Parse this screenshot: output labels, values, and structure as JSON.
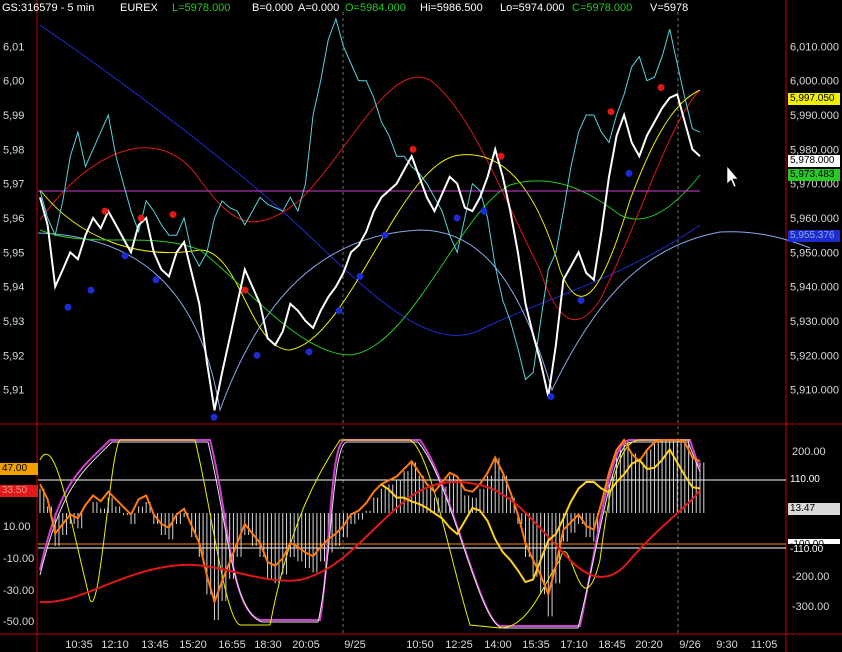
{
  "header": {
    "symbol": "GS:316579 - 5 min",
    "exchange": "EUREX",
    "last": "L=5978.000",
    "bid": "B=0.000",
    "ask": "A=0.000",
    "open": "O=5984.000",
    "high": "Hi=5986.500",
    "low": "Lo=5974.000",
    "close": "C=5978.000",
    "volume": "V=5978"
  },
  "colors": {
    "background": "#000000",
    "price": "#ffffff",
    "cyan": "#5ad2dc",
    "red": "#e01818",
    "yellow": "#f0f000",
    "green": "#28c828",
    "blue": "#1c2cd0",
    "lightblue": "#8aa8e8",
    "magenta": "#d040d0",
    "orange": "#ff7a10",
    "axis_red": "#c00000"
  },
  "price_axis": {
    "left_labels": [
      "6,01",
      "6,00",
      "5,99",
      "5,98",
      "5,97",
      "5,96",
      "5,95",
      "5,94",
      "5,93",
      "5,92",
      "5,91"
    ],
    "right_labels": [
      "6,010.000",
      "6,000.000",
      "5,990.000",
      "5,980.000",
      "5,970.000",
      "5,960.000",
      "5,950.000",
      "5,940.000",
      "5,930.000",
      "5,920.000",
      "5,910.000"
    ],
    "tags": [
      {
        "text": "5,997.050",
        "bg": "#f0f000"
      },
      {
        "text": "5,978.000",
        "bg": "#ffffff"
      },
      {
        "text": "5,973.483",
        "bg": "#28c828"
      },
      {
        "text": "5,955.376",
        "bg": "#1c2cd0"
      }
    ]
  },
  "osc_axis": {
    "left_labels": [
      "10.00",
      "-10.00",
      "-30.00",
      "-50.00"
    ],
    "right_labels": [
      "200.00",
      "-200.00",
      "-300.00"
    ],
    "left_tags": [
      {
        "text": "47.00",
        "bg": "#f0a000",
        "fg": "#000000"
      },
      {
        "text": "33.50",
        "bg": "#e01818",
        "fg": "#ff9090"
      }
    ],
    "right_tags": [
      {
        "text": "110.00",
        "bg": "#000000",
        "fg": "#ffffff"
      },
      {
        "text": "13.47",
        "bg": "#d8d8d8",
        "fg": "#000000"
      },
      {
        "text": "-100.00",
        "bg": "#ffffff",
        "fg": "#000000"
      },
      {
        "text": "-110.00",
        "bg": "#000000",
        "fg": "#ffffff"
      }
    ]
  },
  "time_axis": {
    "labels": [
      "10:35",
      "12:10",
      "13:45",
      "15:20",
      "16:55",
      "18:30",
      "20:05",
      "9/25",
      "10:50",
      "12:25",
      "14:00",
      "15:35",
      "17:10",
      "18:45",
      "20:20",
      "9/26",
      "9:30",
      "11:05"
    ]
  },
  "chart_data": {
    "type": "line",
    "title": "GS:316579 - 5 min",
    "x_ticks": [
      "10:35",
      "12:10",
      "13:45",
      "15:20",
      "16:55",
      "18:30",
      "20:05",
      "9/25",
      "10:50",
      "12:25",
      "14:00",
      "15:35",
      "17:10",
      "18:45",
      "20:20",
      "9/26",
      "9:30",
      "11:05"
    ],
    "price_panel": {
      "ylim": [
        5900,
        6020
      ],
      "series": [
        {
          "values": [
            5966,
            5958,
            5940,
            5945,
            5950,
            5948,
            5955,
            5960,
            5957,
            5962,
            5958,
            5954,
            5950,
            5958,
            5960,
            5950,
            5945,
            5943,
            5950,
            5953,
            5944,
            5935,
            5918,
            5904,
            5915,
            5925,
            5935,
            5945,
            5940,
            5935,
            5925,
            5923,
            5927,
            5935,
            5933,
            5930,
            5928,
            5933,
            5937,
            5940,
            5944,
            5950,
            5952,
            5956,
            5962,
            5966,
            5968,
            5970,
            5974,
            5978,
            5972,
            5966,
            5962,
            5967,
            5972,
            5970,
            5963,
            5962,
            5966,
            5972,
            5980,
            5972,
            5962,
            5950,
            5935,
            5926,
            5918,
            5908,
            5923,
            5942,
            5946,
            5950,
            5944,
            5942,
            5956,
            5972,
            5984,
            5990,
            5982,
            5978,
            5984,
            5988,
            5992,
            5995,
            5996,
            5988,
            5980,
            5978
          ]
        },
        {
          "values": [
            5968,
            5960,
            5955,
            5965,
            5978,
            5985,
            5975,
            5980,
            5985,
            5990,
            5978,
            5970,
            5962,
            5956,
            5965,
            5962,
            5958,
            5955,
            5955,
            5960,
            5950,
            5946,
            5950,
            5960,
            5965,
            5963,
            5962,
            5958,
            5962,
            5966,
            5964,
            5963,
            5962,
            5966,
            5962,
            5970,
            5990,
            6000,
            6012,
            6018,
            6010,
            6005,
            6000,
            6000,
            5995,
            5988,
            5984,
            5978,
            5978,
            5975,
            5973,
            5970,
            5966,
            5962,
            5955,
            5950,
            5960,
            5970,
            5968,
            5960,
            5946,
            5936,
            5930,
            5922,
            5913,
            5915,
            5930,
            5945,
            5950,
            5962,
            5975,
            5985,
            5990,
            5990,
            5985,
            5982,
            5990,
            5996,
            6004,
            6007,
            6000,
            6001,
            6007,
            6015,
            6005,
            5995,
            5986,
            5985
          ]
        }
      ],
      "horizontal_lines": [
        5968.5
      ],
      "red_dots": [
        [
          5962
        ],
        [
          5960
        ],
        [
          5961
        ],
        [
          5939
        ],
        [
          5980
        ],
        [
          5978
        ],
        [
          5991
        ],
        [
          5998
        ]
      ],
      "blue_dots": [
        [
          5934
        ],
        [
          5939
        ],
        [
          5949
        ],
        [
          5942
        ],
        [
          5902
        ],
        [
          5920
        ],
        [
          5921
        ],
        [
          5933
        ],
        [
          5943
        ],
        [
          5955
        ],
        [
          5960
        ],
        [
          5962
        ],
        [
          5908
        ],
        [
          5936
        ],
        [
          5973
        ]
      ]
    },
    "oscillator_panel": {
      "ylim": [
        -55,
        65
      ],
      "right_ylim": [
        -330,
        280
      ],
      "levels": [
        110,
        -110
      ]
    }
  }
}
